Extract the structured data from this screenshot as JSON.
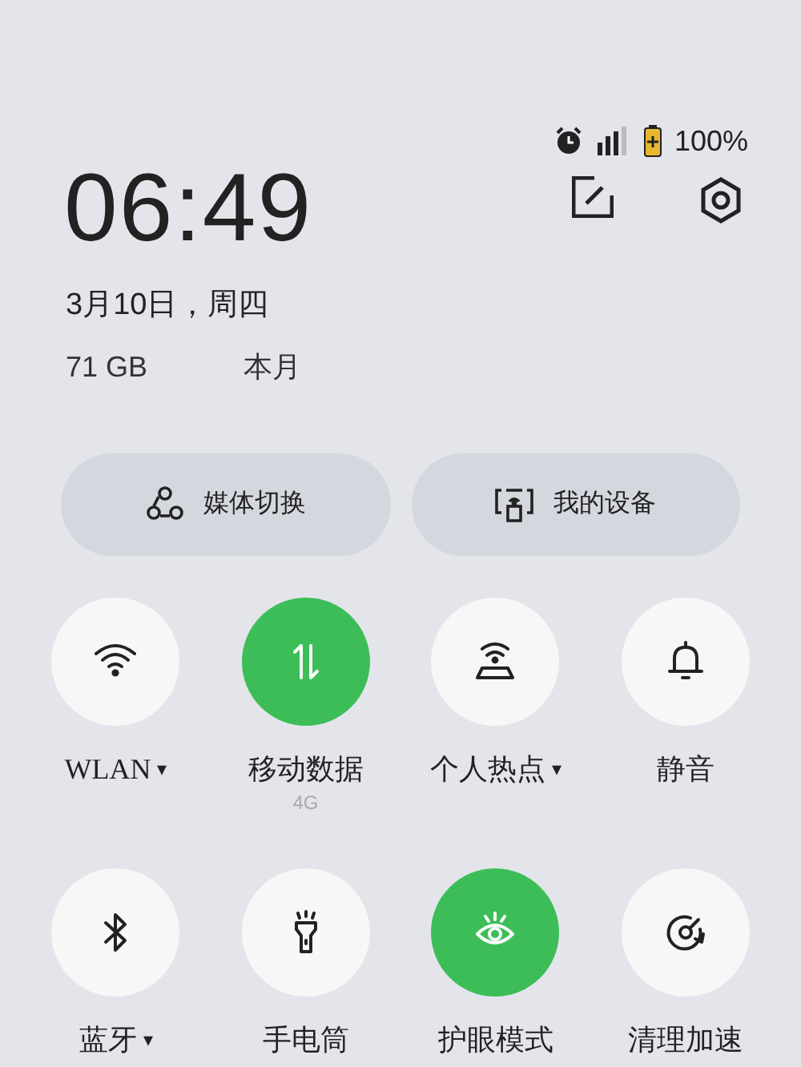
{
  "status_bar": {
    "battery": "100%"
  },
  "header": {
    "time": "06:49",
    "date": "3月10日，周四",
    "data_usage": "71 GB",
    "data_period": "本月"
  },
  "shortcuts": [
    {
      "kind": "media",
      "label": "媒体切换"
    },
    {
      "kind": "devices",
      "label": "我的设备"
    }
  ],
  "tiles": [
    {
      "kind": "wifi",
      "label": "WLAN",
      "on": false,
      "caret": "▾"
    },
    {
      "kind": "data",
      "label": "移动数据",
      "on": true,
      "subtitle": "4G"
    },
    {
      "kind": "hotspot",
      "label": "个人热点",
      "on": false,
      "caret": "▾"
    },
    {
      "kind": "bell",
      "label": "静音",
      "on": false
    },
    {
      "kind": "bluetooth",
      "label": "蓝牙",
      "on": false,
      "caret": "▾"
    },
    {
      "kind": "torch",
      "label": "手电筒",
      "on": false
    },
    {
      "kind": "eye",
      "label": "护眼模式",
      "on": true
    },
    {
      "kind": "cleaner",
      "label": "清理加速",
      "on": false
    }
  ]
}
